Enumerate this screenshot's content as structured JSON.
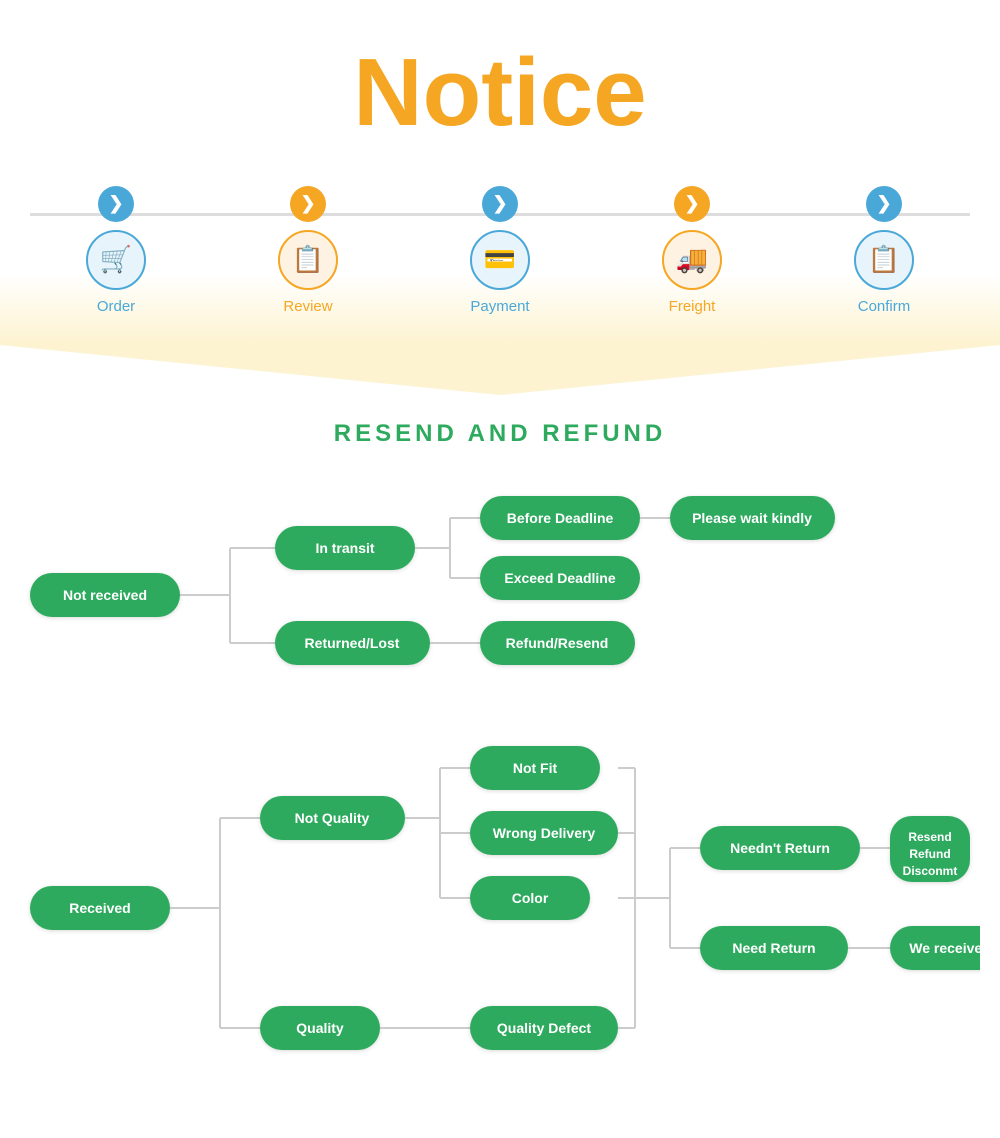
{
  "title": "Notice",
  "timeline": {
    "steps": [
      {
        "id": "order",
        "label": "Order",
        "icon": "🛒",
        "arrow_color": "blue",
        "icon_color": "blue",
        "label_color": "blue"
      },
      {
        "id": "review",
        "label": "Review",
        "icon": "📋",
        "arrow_color": "orange",
        "icon_color": "orange",
        "label_color": "orange"
      },
      {
        "id": "payment",
        "label": "Payment",
        "icon": "💳",
        "arrow_color": "blue",
        "icon_color": "blue",
        "label_color": "blue"
      },
      {
        "id": "freight",
        "label": "Freight",
        "icon": "🚚",
        "arrow_color": "orange",
        "icon_color": "orange",
        "label_color": "orange"
      },
      {
        "id": "confirm",
        "label": "Confirm",
        "icon": "📋",
        "arrow_color": "blue",
        "icon_color": "blue",
        "label_color": "blue"
      }
    ]
  },
  "section_title": "RESEND AND REFUND",
  "flow": {
    "top": {
      "root": "Not received",
      "branches": [
        {
          "label": "In transit",
          "children": [
            {
              "label": "Before Deadline",
              "leaf": "Please wait kindly"
            },
            {
              "label": "Exceed Deadline",
              "leaf": null
            }
          ]
        },
        {
          "label": "Returned/Lost",
          "children": [
            {
              "label": "Refund/Resend",
              "leaf": null
            }
          ]
        }
      ]
    },
    "bottom": {
      "root": "Received",
      "branches": [
        {
          "label": "Not Quality",
          "children": [
            {
              "label": "Not Fit"
            },
            {
              "label": "Wrong Delivery"
            },
            {
              "label": "Color"
            }
          ]
        },
        {
          "label": "Quality",
          "children": [
            {
              "label": "Quality Defect"
            }
          ]
        }
      ],
      "outcomes": [
        {
          "label": "Needn't Return",
          "leaf": "Resend Refund Disconmt"
        },
        {
          "label": "Need Return",
          "leaf": "We received"
        }
      ]
    }
  }
}
